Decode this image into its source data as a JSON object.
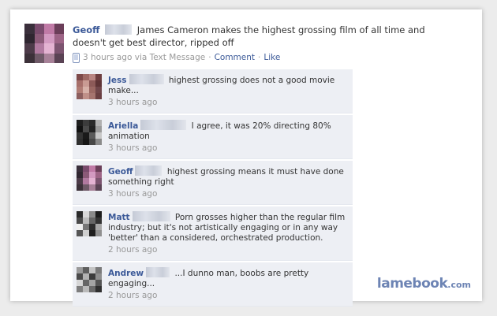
{
  "post": {
    "author": "Geoff",
    "text": "James Cameron makes the highest grossing film of all time and doesn't get best director, ripped off",
    "time": "3 hours ago via Text Message",
    "comment_link": "Comment",
    "like_link": "Like",
    "separator": "·",
    "avatar_colors": [
      "#3a2f3b",
      "#7a4b6d",
      "#c07aa6",
      "#6b3e59",
      "#2f2630",
      "#8b5a78",
      "#d39ac1",
      "#9d6486",
      "#4d3b49",
      "#b17aa0",
      "#e4b3d2",
      "#7c5470",
      "#3c3139",
      "#6f5a68",
      "#a78198",
      "#5a4354"
    ]
  },
  "comments": [
    {
      "author": "Jess",
      "text": "highest grossing does not a good movie make...",
      "time": "3 hours ago",
      "avatar_colors": [
        "#7d4a4a",
        "#9f6a66",
        "#b98582",
        "#6e3e40",
        "#a66f6a",
        "#c99b93",
        "#8c5a58",
        "#5e3436",
        "#b07c74",
        "#d7b1a8",
        "#9a6863",
        "#70464a",
        "#8d5f5e",
        "#c09088",
        "#a5746f",
        "#6a3f42"
      ]
    },
    {
      "author": "Ariella",
      "text": "I agree, it was 20% directing 80% animation",
      "time": "3 hours ago",
      "avatar_colors": [
        "#1e1e1e",
        "#3c3c3c",
        "#2a2a2a",
        "#b0b0b0",
        "#111111",
        "#4a4a4a",
        "#222222",
        "#9a9a9a",
        "#333333",
        "#1a1a1a",
        "#5a5a5a",
        "#c8c8c8",
        "#2e2e2e",
        "#161616",
        "#474747",
        "#8a8a8a"
      ]
    },
    {
      "author": "Geoff",
      "text": "highest grossing means it must have done something right",
      "time": "3 hours ago",
      "avatar_colors": [
        "#3a2f3b",
        "#7a4b6d",
        "#c07aa6",
        "#6b3e59",
        "#2f2630",
        "#8b5a78",
        "#d39ac1",
        "#9d6486",
        "#4d3b49",
        "#b17aa0",
        "#e4b3d2",
        "#7c5470",
        "#3c3139",
        "#6f5a68",
        "#a78198",
        "#5a4354"
      ]
    },
    {
      "author": "Matt",
      "text": "Porn grosses higher than the regular film industry; but it's not artistically engaging or in any way 'better' than a considered, orchestrated production.",
      "time": "2 hours ago",
      "avatar_colors": [
        "#2a2a2a",
        "#d8d8d8",
        "#8a8a8a",
        "#1c1c1c",
        "#4a4a4a",
        "#bcbcbc",
        "#666666",
        "#333333",
        "#f0f0f0",
        "#777777",
        "#2e2e2e",
        "#a8a8a8",
        "#555555",
        "#cfcfcf",
        "#1e1e1e",
        "#909090"
      ]
    },
    {
      "author": "Andrew",
      "text": "...I dunno man, boobs are pretty engaging...",
      "time": "2 hours ago",
      "avatar_colors": [
        "#9a9a9a",
        "#5e5e5e",
        "#c4c4c4",
        "#7a7a7a",
        "#4a4a4a",
        "#b2b2b2",
        "#3c3c3c",
        "#8e8e8e",
        "#d6d6d6",
        "#666666",
        "#a4a4a4",
        "#545454",
        "#7e7e7e",
        "#bababa",
        "#6a6a6a",
        "#2f2f2f"
      ]
    }
  ],
  "watermark": {
    "brand": "lamebook",
    "domain": ".com"
  }
}
